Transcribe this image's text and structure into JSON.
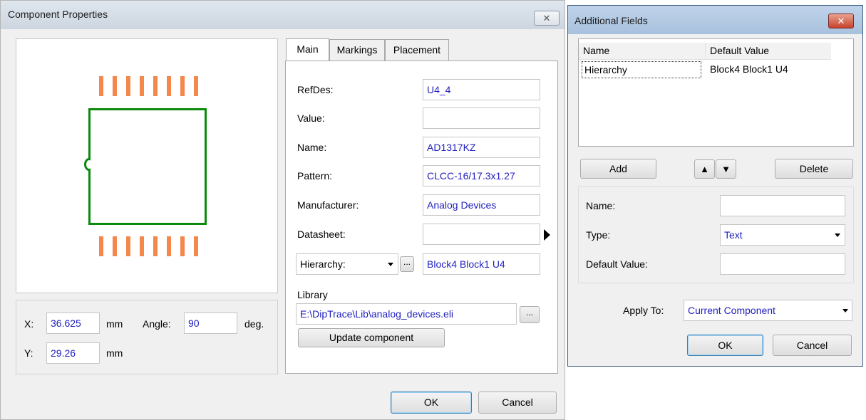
{
  "component_properties": {
    "title": "Component Properties",
    "close_glyph": "✕",
    "x_label": "X:",
    "x_value": "36.625",
    "y_label": "Y:",
    "y_value": "29.26",
    "unit_mm": "mm",
    "angle_label": "Angle:",
    "angle_value": "90",
    "unit_deg": "deg.",
    "tabs": {
      "main": "Main",
      "markings": "Markings",
      "placement": "Placement"
    },
    "fields": {
      "refdes": {
        "label": "RefDes:",
        "value": "U4_4"
      },
      "value": {
        "label": "Value:",
        "value": ""
      },
      "name": {
        "label": "Name:",
        "value": "AD1317KZ"
      },
      "pattern": {
        "label": "Pattern:",
        "value": "CLCC-16/17.3x1.27"
      },
      "manufacturer": {
        "label": "Manufacturer:",
        "value": "Analog Devices"
      },
      "datasheet": {
        "label": "Datasheet:",
        "value": ""
      },
      "hierarchy": {
        "label": "Hierarchy:",
        "value": "Block4 Block1 U4"
      }
    },
    "ellipsis": "...",
    "library_label": "Library",
    "library_path": "E:\\DipTrace\\Lib\\analog_devices.eli",
    "update_button": "Update component",
    "ok_button": "OK",
    "cancel_button": "Cancel",
    "colors": {
      "pad": "#f4874b",
      "outline": "#0a8a0a",
      "value_text": "#1f1fbf"
    }
  },
  "additional_fields": {
    "title": "Additional Fields",
    "close_glyph": "✕",
    "columns": [
      "Name",
      "Default Value"
    ],
    "rows": [
      {
        "name": "Hierarchy",
        "default_value": "Block4 Block1 U4"
      }
    ],
    "add_button": "Add",
    "delete_button": "Delete",
    "up_glyph": "▲",
    "down_glyph": "▼",
    "name_label": "Name:",
    "name_value": "",
    "type_label": "Type:",
    "type_value": "Text",
    "default_label": "Default Value:",
    "default_value": "",
    "apply_label": "Apply To:",
    "apply_value": "Current Component",
    "ok_button": "OK",
    "cancel_button": "Cancel"
  }
}
